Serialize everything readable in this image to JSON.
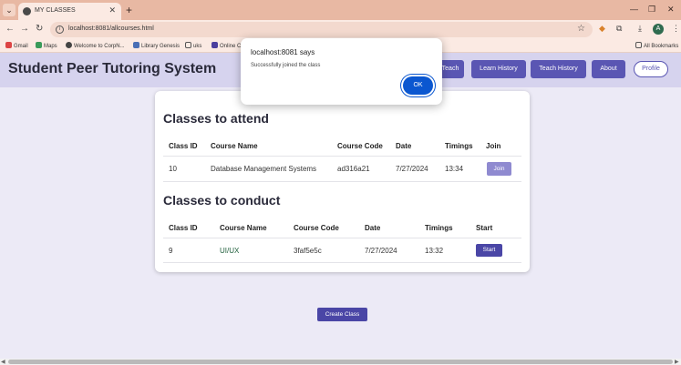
{
  "browser": {
    "tab_title": "MY CLASSES",
    "url": "localhost:8081/allcourses.html",
    "bookmarks": [
      "Gmail",
      "Maps",
      "Welcome to CorpN...",
      "Library Genesis",
      "uks",
      "Online C"
    ],
    "all_bookmarks": "All Bookmarks",
    "profile_initial": "A",
    "colors": {
      "frame": "#e8b8a3",
      "toolbar": "#fbeae3"
    }
  },
  "app": {
    "title": "Student Peer Tutoring System",
    "nav": [
      "Teach",
      "Learn History",
      "Teach History",
      "About"
    ],
    "profile": "Profile",
    "accent": "#5a56b3"
  },
  "attend": {
    "title": "Classes to attend",
    "headers": [
      "Class ID",
      "Course Name",
      "Course Code",
      "Date",
      "Timings",
      "Join"
    ],
    "row": {
      "id": "10",
      "name": "Database Management Systems",
      "code": "ad316a21",
      "date": "7/27/2024",
      "time": "13:34",
      "action": "Join"
    }
  },
  "conduct": {
    "title": "Classes to conduct",
    "headers": [
      "Class ID",
      "Course Name",
      "Course Code",
      "Date",
      "Timings",
      "Start"
    ],
    "row": {
      "id": "9",
      "name": "UI/UX",
      "code": "3faf5e5c",
      "date": "7/27/2024",
      "time": "13:32",
      "action": "Start"
    }
  },
  "create_button": "Create Class",
  "dialog": {
    "title": "localhost:8081 says",
    "message": "Successfully joined the class",
    "ok": "OK"
  }
}
